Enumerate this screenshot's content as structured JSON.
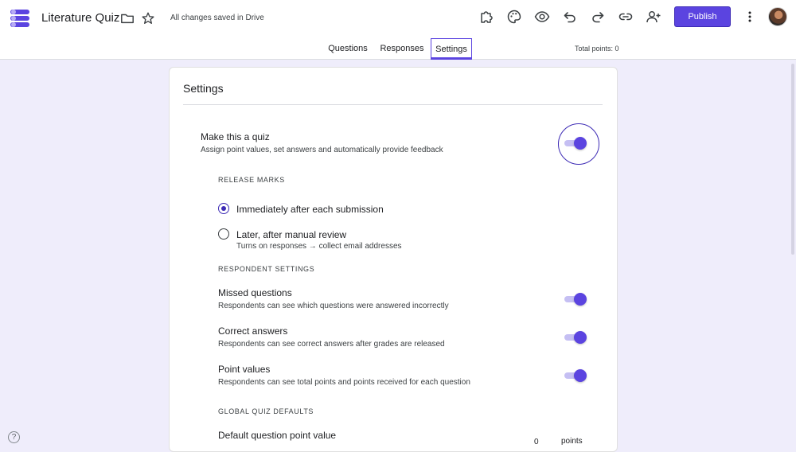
{
  "header": {
    "title": "Literature Quiz",
    "save_status": "All changes saved in Drive",
    "publish_label": "Publish",
    "icons": [
      "addons-icon",
      "palette-icon",
      "preview-icon",
      "undo-icon",
      "redo-icon",
      "link-icon",
      "add-collaborator-icon",
      "more-vert-icon"
    ]
  },
  "tabs": [
    {
      "label": "Questions",
      "active": false
    },
    {
      "label": "Responses",
      "active": false
    },
    {
      "label": "Settings",
      "active": true
    }
  ],
  "total_points": "Total points: 0",
  "settings": {
    "title": "Settings",
    "quiz": {
      "title": "Make this a quiz",
      "desc": "Assign point values, set answers and automatically provide feedback",
      "enabled": true
    },
    "release_marks": {
      "label": "RELEASE MARKS",
      "options": [
        {
          "label": "Immediately after each submission",
          "selected": true
        },
        {
          "label": "Later, after manual review",
          "desc": "Turns on responses → collect email addresses",
          "selected": false
        }
      ]
    },
    "respondent": {
      "label": "RESPONDENT SETTINGS",
      "items": [
        {
          "title": "Missed questions",
          "desc": "Respondents can see which questions were answered incorrectly",
          "enabled": true
        },
        {
          "title": "Correct answers",
          "desc": "Respondents can see correct answers after grades are released",
          "enabled": true
        },
        {
          "title": "Point values",
          "desc": "Respondents can see total points and points received for each question",
          "enabled": true
        }
      ]
    },
    "defaults": {
      "label": "GLOBAL QUIZ DEFAULTS",
      "point_title": "Default question point value",
      "point_value": "0",
      "point_unit": "points"
    }
  },
  "colors": {
    "accent": "#5b44e0",
    "background": "#efedfb"
  }
}
